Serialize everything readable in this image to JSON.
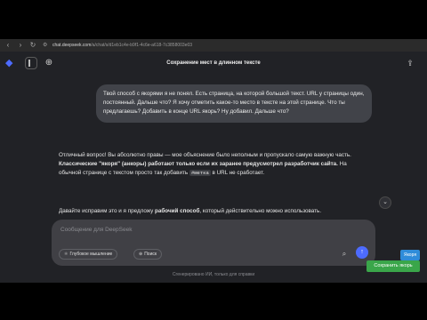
{
  "browser": {
    "url_host": "chat.deepseek.com",
    "url_path": "/a/chat/s/d1eb1c4e-b9f1-4c6e-a618-7c3858003e03"
  },
  "app": {
    "title": "Сохранение мест в длинном тексте"
  },
  "user_message": "Твой способ с якорями я не понял. Есть страница, на которой большой текст. URL у страницы один, постоянный. Дальше что? Я хочу отметить какое-то место в тексте на этой странице. Что ты предлагаешь? Добавить в конце URL якорь? Ну добавил. Дальше что?",
  "answer": {
    "p1_a": "Отличный вопрос! Вы абсолютно правы — мое объяснение было неполным и пропускало самую важную часть. ",
    "p1_bold": "Классические \"якоря\" (анкоры) работают только если их заранее предусмотрел разработчик сайта.",
    "p1_b": " На обычной странице с текстом просто так добавить ",
    "p1_code": "#метка",
    "p1_c": " в URL не сработает.",
    "p2_a": "Давайте исправим это и я предложу ",
    "p2_bold": "рабочий способ",
    "p2_b": ", который действительно можно использовать."
  },
  "composer": {
    "placeholder": "Сообщение для DeepSeek",
    "deep_think_label": "Глубокое мышление",
    "search_label": "Поиск"
  },
  "footer": "Сгенерировано ИИ, только для справки",
  "overlay": {
    "copy_label": "Якоря",
    "save_label": "Сохранить якорь"
  },
  "colors": {
    "accent": "#4d6bfe",
    "save_button": "#3aa64a",
    "copy_button": "#2f8cd9"
  }
}
